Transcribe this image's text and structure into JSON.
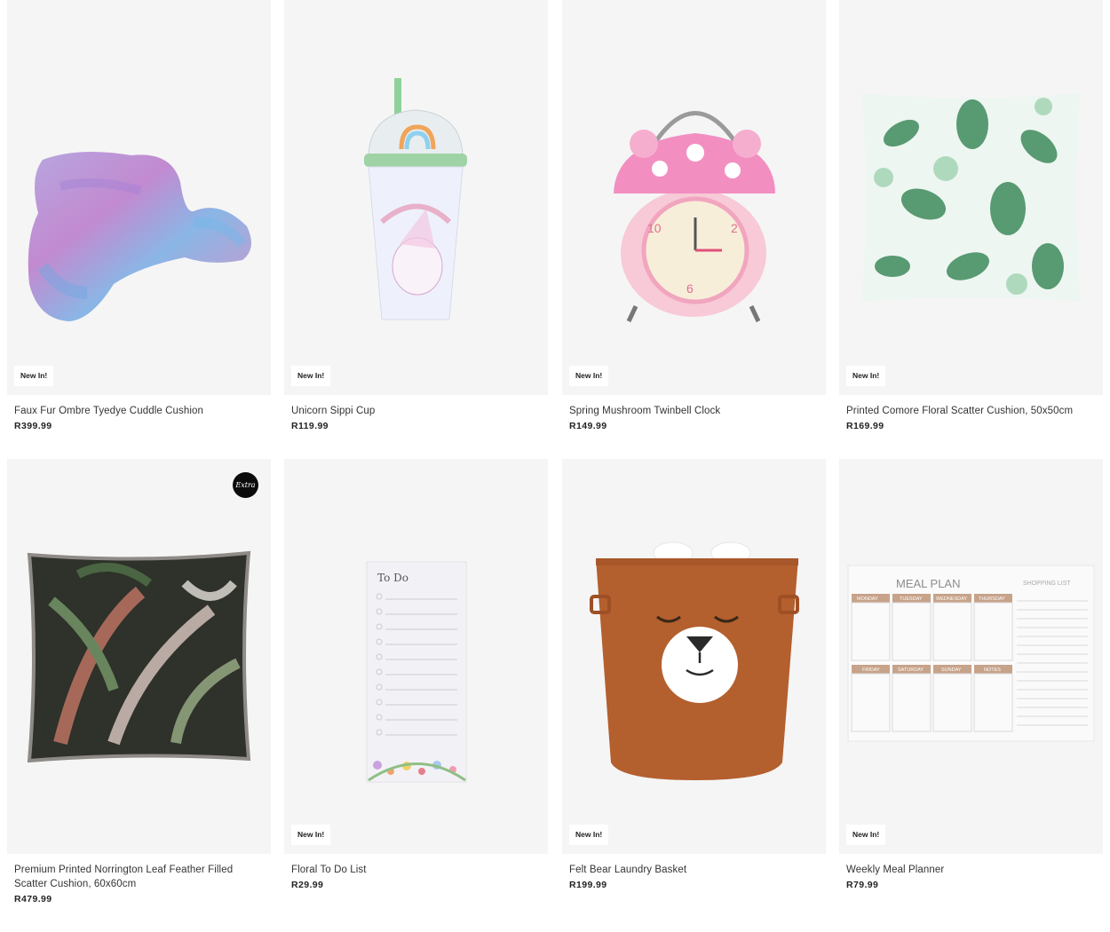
{
  "products": [
    {
      "badge": "New In!",
      "title": "Faux Fur Ombre Tyedye Cuddle Cushion",
      "price": "R399.99"
    },
    {
      "badge": "New In!",
      "title": "Unicorn Sippi Cup",
      "price": "R119.99"
    },
    {
      "badge": "New In!",
      "title": "Spring Mushroom Twinbell Clock",
      "price": "R149.99"
    },
    {
      "badge": "New In!",
      "title": "Printed Comore Floral Scatter Cushion, 50x50cm",
      "price": "R169.99"
    },
    {
      "badge": "",
      "title": "Premium Printed Norrington Leaf Feather Filled Scatter Cushion, 60x60cm",
      "price": "R479.99",
      "extra_badge": "Extra"
    },
    {
      "badge": "New In!",
      "title": "Floral To Do List",
      "price": "R29.99"
    },
    {
      "badge": "New In!",
      "title": "Felt Bear Laundry Basket",
      "price": "R199.99"
    },
    {
      "badge": "New In!",
      "title": "Weekly Meal Planner",
      "price": "R79.99"
    }
  ],
  "product_art": {
    "todo_heading": "To Do",
    "meal_plan_heading": "MEAL PLAN",
    "shopping_list_label": "SHOPPING LIST",
    "meal_days_top": [
      "MONDAY",
      "TUESDAY",
      "WEDNESDAY",
      "THURSDAY"
    ],
    "meal_days_bottom": [
      "FRIDAY",
      "SATURDAY",
      "SUNDAY",
      "NOTES"
    ]
  }
}
